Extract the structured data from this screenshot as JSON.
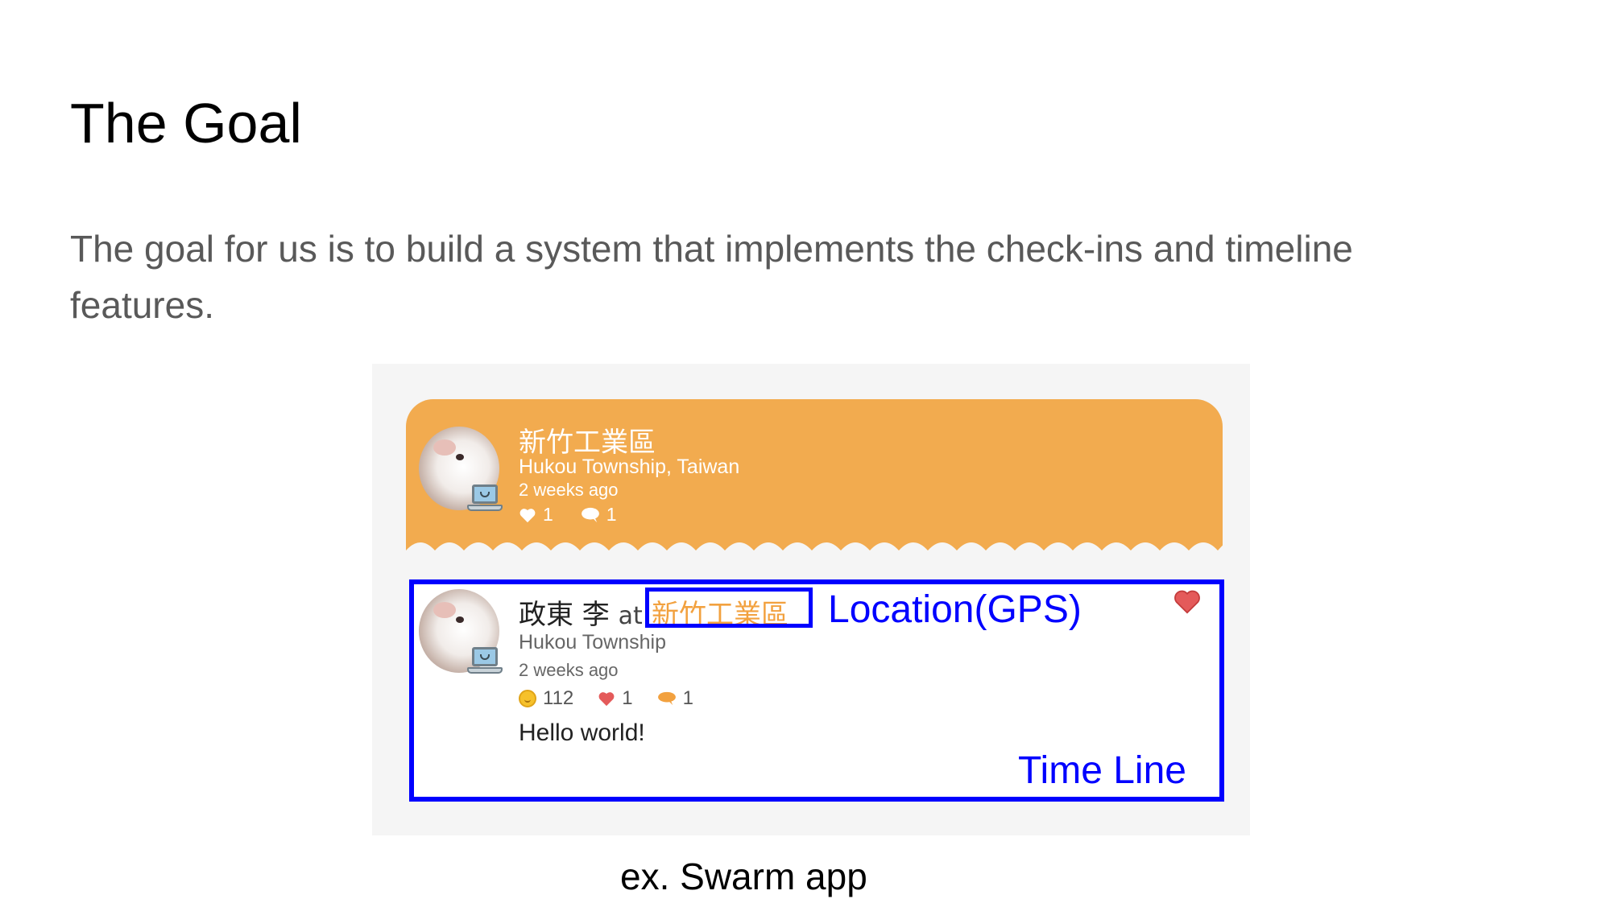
{
  "slide": {
    "title": "The Goal",
    "body": "The goal for us is to build a system that implements the check-ins and timeline features.",
    "caption": "ex. Swarm app"
  },
  "checkin_card": {
    "venue": "新竹工業區",
    "location": "Hukou Township, Taiwan",
    "time_ago": "2 weeks ago",
    "likes": "1",
    "comments": "1",
    "header_color": "#f2ab4f"
  },
  "timeline_item": {
    "user": "政東 李",
    "at": "at",
    "venue": "新竹工業區",
    "location": "Hukou Township",
    "time_ago": "2 weeks ago",
    "coins": "112",
    "likes": "1",
    "comments": "1",
    "message": "Hello world!"
  },
  "annotations": {
    "location_label": "Location(GPS)",
    "timeline_label": "Time Line",
    "highlight_color": "#0000ff"
  },
  "icons": [
    "heart-icon",
    "comment-icon",
    "coin-icon",
    "laptop-icon",
    "heart-outline-icon"
  ]
}
